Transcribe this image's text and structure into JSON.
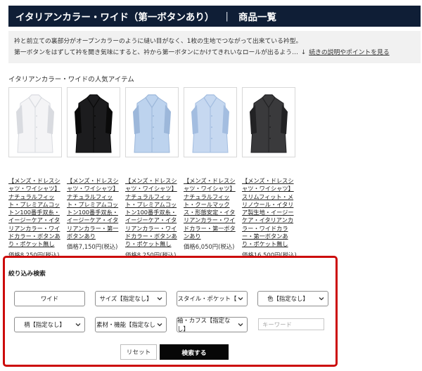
{
  "header": {
    "title": "イタリアンカラー・ワイド（第一ボタンあり）",
    "separator": "|",
    "subtitle": "商品一覧"
  },
  "description": {
    "line1": "衿と前立ての裏部分がオープンカラーのように縫い目がなく、1枚の生地でつながって出来ている衿型。",
    "line2": "第一ボタンをはずして衿を開き気味にすると、衿から第一ボタンにかけてきれいなロールが出るよう…",
    "more_arrow": "↓",
    "more_link": "続きの説明やポイントを見る"
  },
  "popular": {
    "title": "イタリアンカラー・ワイドの人気アイテム",
    "items": [
      {
        "name": "【メンズ・ドレスシャツ・ワイシャツ】ナチュラルフィット・プレミアムコットン100番手双糸・イージーケア・イタリアンカラー・ワイドカラー・ボタンあり・ポケット無し",
        "price": "価格8,250円(税込)",
        "shirt_color": "#f4f4f6",
        "shade_color": "#d9dbe0"
      },
      {
        "name": "【メンズ・ドレスシャツ・ワイシャツ】ナチュラルフィット・プレミアムコットン100番手双糸・イージーケア・イタリアンカラー・第一ボタンあり",
        "price": "価格7,150円(税込)",
        "shirt_color": "#1c1c1e",
        "shade_color": "#0a0a0a"
      },
      {
        "name": "【メンズ・ドレスシャツ・ワイシャツ】ナチュラルフィット・プレミアムコットン100番手双糸・イージーケア・イタリアンカラー・ワイドカラー・ボタンあり・ポケット無し",
        "price": "価格8,250円(税込)",
        "shirt_color": "#bdd3ee",
        "shade_color": "#9cb7da"
      },
      {
        "name": "【メンズ・ドレスシャツ・ワイシャツ】ナチュラルフィット・クールマックス・形態安定・イタリアンカラー・ワイドカラー・第一ボタンあり",
        "price": "価格6,050円(税込)",
        "shirt_color": "#c6d8f0",
        "shade_color": "#a3bde0"
      },
      {
        "name": "【メンズ・ドレスシャツ・ワイシャツ】スリムフィット・メリノウール・イタリア製生地・イージーケア・イタリアンカラー・ワイドカラー・第一ボタンあり・ポケット無し",
        "price": "価格16,500円(税込)",
        "shirt_color": "#3a3a3c",
        "shade_color": "#222224"
      }
    ]
  },
  "filter": {
    "title": "絞り込み検索",
    "row1": [
      "ワイド",
      "サイズ【指定なし】",
      "スタイル・ポケット【",
      "色【指定なし】"
    ],
    "row2": [
      "柄【指定なし】",
      "素材・機能【指定なし",
      "袖・カフス【指定なし】"
    ],
    "keyword_placeholder": "キーワード",
    "reset_label": "リセット",
    "search_label": "検索する"
  },
  "colors": {
    "header_bg": "#0f1e36",
    "highlight_border": "#cc0a0a",
    "search_button_bg": "#070707"
  }
}
